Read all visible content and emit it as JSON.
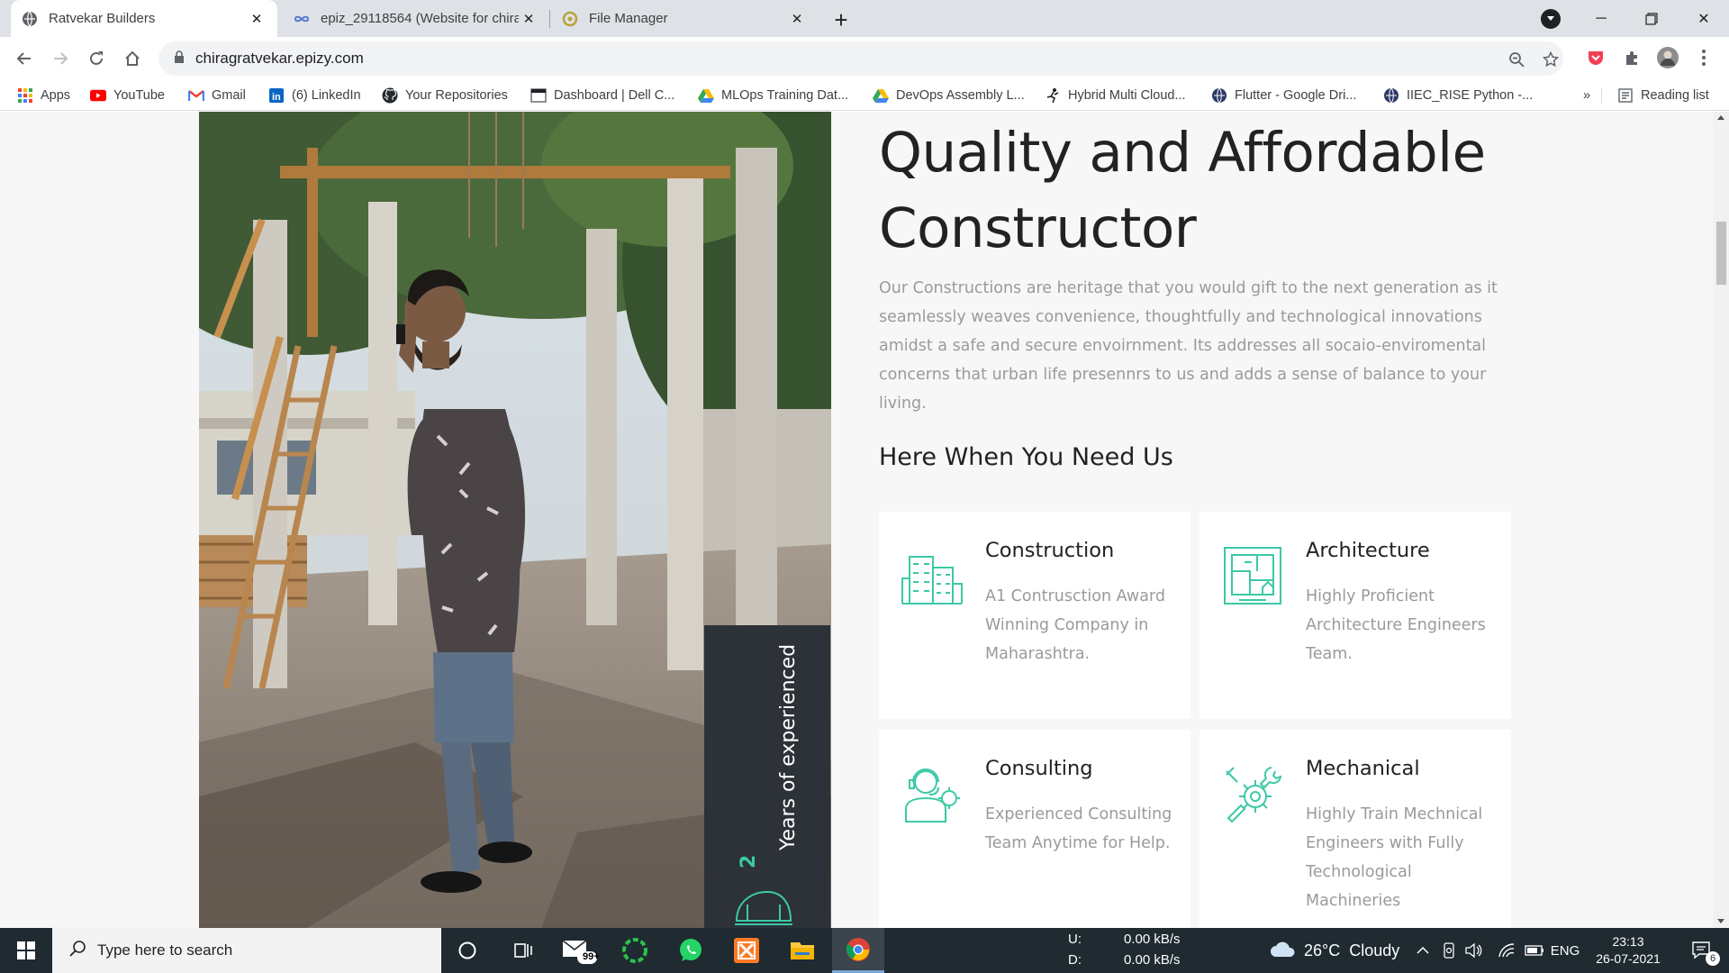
{
  "browser": {
    "tabs": [
      {
        "title": "Ratvekar Builders",
        "active": true
      },
      {
        "title": "epiz_29118564 (Website for chira",
        "active": false
      },
      {
        "title": "File Manager",
        "active": false
      }
    ],
    "url": "chiragratvekar.epizy.com",
    "bookmarks": [
      {
        "label": "Apps",
        "icon": "apps-grid-icon"
      },
      {
        "label": "YouTube",
        "icon": "youtube-icon"
      },
      {
        "label": "Gmail",
        "icon": "gmail-icon"
      },
      {
        "label": "(6) LinkedIn",
        "icon": "linkedin-icon"
      },
      {
        "label": "Your Repositories",
        "icon": "github-icon"
      },
      {
        "label": "Dashboard | Dell C...",
        "icon": "page-icon"
      },
      {
        "label": "MLOps Training Dat...",
        "icon": "drive-icon"
      },
      {
        "label": "DevOps Assembly L...",
        "icon": "drive-icon"
      },
      {
        "label": "Hybrid Multi Cloud...",
        "icon": "figure-icon"
      },
      {
        "label": "Flutter - Google Dri...",
        "icon": "globe-icon"
      },
      {
        "label": "IIEC_RISE Python -...",
        "icon": "globe-icon"
      }
    ],
    "more_bookmarks": "»",
    "reading_list": "Reading list"
  },
  "page": {
    "heading": "Quality and Affordable Constructor",
    "heading_line1": "Quality and Affordable",
    "heading_line2": "Constructor",
    "paragraph": "Our Constructions are heritage that you would gift to the next generation as it seamlessly weaves convenience, thoughtfully and technological innovations amidst a safe and secure envoirnment. Its addresses all socaio-enviromental concerns that urban life presennrs to us and adds a sense of balance to your living.",
    "subheading": "Here When You Need Us",
    "experience_number": "2",
    "experience_text": "Years of experienced",
    "services": [
      {
        "title": "Construction",
        "text": "A1 Contrusction Award Winning Company in Maharashtra.",
        "icon": "building-icon"
      },
      {
        "title": "Architecture",
        "text": "Highly Proficient Architecture Engineers Team.",
        "icon": "blueprint-icon"
      },
      {
        "title": "Consulting",
        "text": "Experienced Consulting Team Anytime for Help.",
        "icon": "consultant-icon"
      },
      {
        "title": "Mechanical",
        "text": "Highly Train Mechnical Engineers with Fully Technological Machineries",
        "icon": "gears-icon"
      }
    ],
    "accent_color": "#3cc9a6"
  },
  "taskbar": {
    "search_placeholder": "Type here to search",
    "mail_badge": "99+",
    "net_upload_label": "U:",
    "net_upload_value": "0.00 kB/s",
    "net_download_label": "D:",
    "net_download_value": "0.00 kB/s",
    "weather": "26°C  Cloudy",
    "language": "ENG",
    "time": "23:13",
    "date": "26-07-2021",
    "notification_count": "6"
  }
}
